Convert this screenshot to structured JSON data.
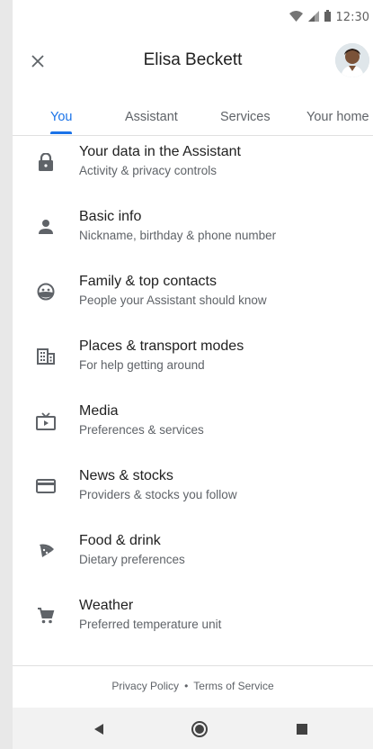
{
  "status_bar": {
    "time": "12:30"
  },
  "header": {
    "title": "Elisa Beckett"
  },
  "tabs": [
    {
      "label": "You",
      "active": true
    },
    {
      "label": "Assistant",
      "active": false
    },
    {
      "label": "Services",
      "active": false
    },
    {
      "label": "Your home",
      "active": false
    }
  ],
  "items": [
    {
      "title": "Your data in the Assistant",
      "subtitle": "Activity & privacy controls",
      "icon": "lock-icon"
    },
    {
      "title": "Basic info",
      "subtitle": "Nickname, birthday & phone number",
      "icon": "person-icon"
    },
    {
      "title": "Family & top contacts",
      "subtitle": "People your Assistant should know",
      "icon": "face-icon"
    },
    {
      "title": "Places & transport modes",
      "subtitle": "For help getting around",
      "icon": "building-icon"
    },
    {
      "title": "Media",
      "subtitle": "Preferences & services",
      "icon": "tv-icon"
    },
    {
      "title": "News & stocks",
      "subtitle": "Providers & stocks you follow",
      "icon": "card-icon"
    },
    {
      "title": "Food & drink",
      "subtitle": "Dietary preferences",
      "icon": "pizza-icon"
    },
    {
      "title": "Weather",
      "subtitle": "Preferred temperature unit",
      "icon": "cart-icon"
    }
  ],
  "footer": {
    "privacy": "Privacy Policy",
    "separator": "•",
    "terms": "Terms of Service"
  },
  "colors": {
    "accent": "#1a73e8",
    "icon": "#5f6368"
  }
}
